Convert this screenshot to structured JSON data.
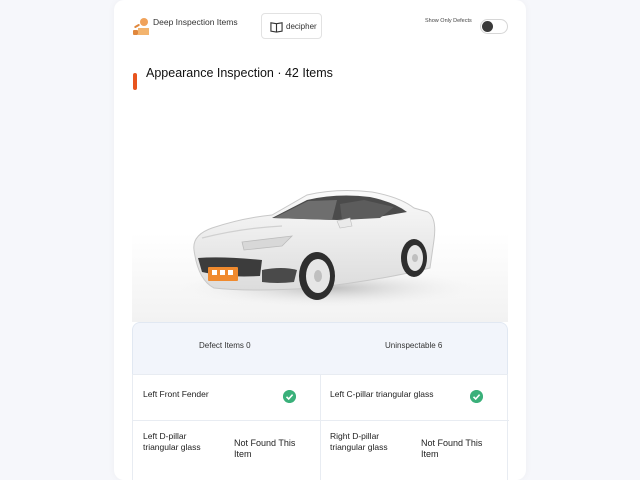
{
  "topbar": {
    "deep_inspection_label": "Deep Inspection Items",
    "decipher_label": "decipher",
    "show_only_defects_label": "Show Only Defects",
    "show_only_defects_on": false
  },
  "section": {
    "title": "Appearance Inspection · 42 Items"
  },
  "summary": {
    "defect_items": "Defect Items 0",
    "uninspectable": "Uninspectable 6"
  },
  "items": [
    {
      "name": "Left Front Fender",
      "status": "ok",
      "status_text": ""
    },
    {
      "name": "Left C-pillar triangular glass",
      "status": "ok",
      "status_text": ""
    },
    {
      "name": "Left D-pillar triangular glass",
      "status": "not_found",
      "status_text": "Not Found This Item"
    },
    {
      "name": "Right D-pillar triangular glass",
      "status": "not_found",
      "status_text": "Not Found This Item"
    }
  ],
  "icons": {
    "mechanic": "mechanic-icon",
    "book": "book-icon",
    "check": "check-circle-icon"
  },
  "colors": {
    "accent": "#e8541e",
    "ok_green": "#3ab07a",
    "summary_bg": "#f2f5fb"
  }
}
